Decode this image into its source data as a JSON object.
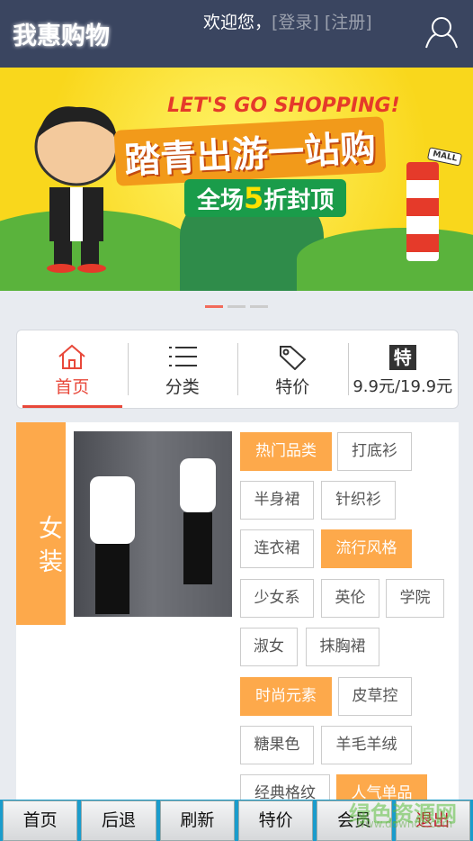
{
  "header": {
    "logo": "我惠购物",
    "welcome": "欢迎您，",
    "login": "[登录]",
    "register": "[注册]"
  },
  "banner": {
    "headline": "LET'S GO SHOPPING!",
    "title": "踏青出游一站购",
    "sub_prefix": "全场",
    "sub_num": "5",
    "sub_suffix": "折封顶",
    "tower_label": "MALL",
    "slides": 3,
    "active_slide": 0
  },
  "nav": [
    {
      "label": "首页",
      "icon": "home-icon"
    },
    {
      "label": "分类",
      "icon": "list-icon"
    },
    {
      "label": "特价",
      "icon": "tag-icon"
    },
    {
      "label": "9.9元/19.9元",
      "icon": "special-icon",
      "icon_text": "特"
    }
  ],
  "category": {
    "label": "女装",
    "tags": [
      {
        "text": "热门品类",
        "hot": true
      },
      {
        "text": "打底衫"
      },
      {
        "text": "半身裙"
      },
      {
        "text": "针织衫"
      },
      {
        "text": "连衣裙"
      },
      {
        "text": "流行风格",
        "hot": true
      },
      {
        "text": "少女系"
      },
      {
        "text": "英伦"
      },
      {
        "text": "学院"
      },
      {
        "text": "淑女"
      },
      {
        "text": "抹胸裙"
      },
      {
        "text": "时尚元素",
        "hot": true
      },
      {
        "text": "皮草控"
      },
      {
        "text": "糖果色"
      },
      {
        "text": "羊毛羊绒"
      },
      {
        "text": "经典格纹"
      },
      {
        "text": "人气单品",
        "hot": true
      }
    ]
  },
  "bottom": [
    "首页",
    "后退",
    "刷新",
    "特价",
    "会员",
    "退出"
  ],
  "watermark": {
    "text": "绿色资源网",
    "url": "www.downcc.com"
  },
  "colors": {
    "header": "#3a4560",
    "accent": "#e8483a",
    "orange": "#fda94b",
    "bar": "#1a9ccc"
  }
}
